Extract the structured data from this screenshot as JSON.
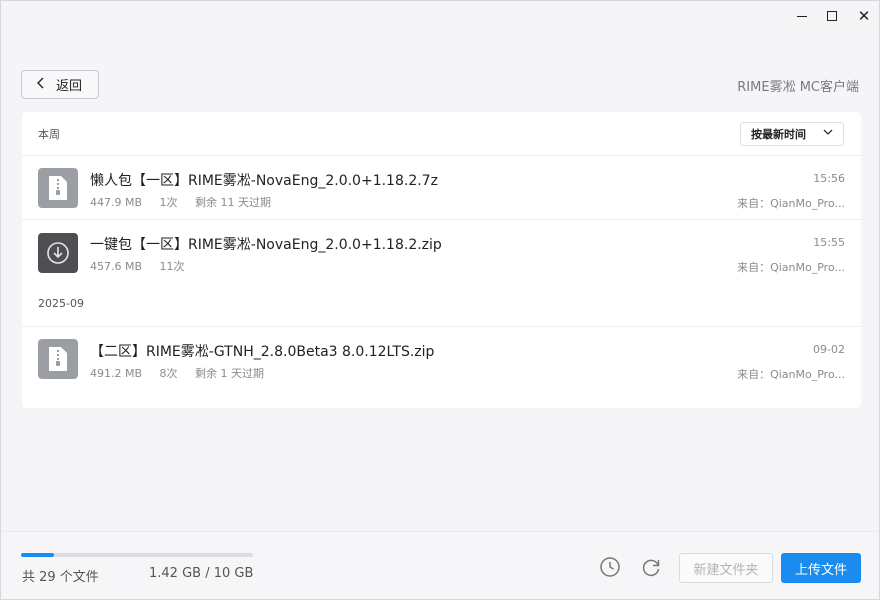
{
  "window": {
    "controls": {
      "minimize": "minimize",
      "maximize": "maximize",
      "close": "close"
    }
  },
  "header": {
    "back_label": "返回",
    "app_title": "RIME雾凇 MC客户端"
  },
  "toolbar": {
    "sort_label": "按最新时间"
  },
  "groups": [
    {
      "label": "本周",
      "files": [
        {
          "name": "懒人包【一区】RIME雾凇-NovaEng_2.0.0+1.18.2.7z",
          "size": "447.9 MB",
          "downloads": "1次",
          "expiry": "剩余 11 天过期",
          "time": "15:56",
          "from": "来自：QianMo_Pro...",
          "icon": "zip-file-icon"
        },
        {
          "name": "一键包【一区】RIME雾凇-NovaEng_2.0.0+1.18.2.zip",
          "size": "457.6 MB",
          "downloads": "11次",
          "expiry": "",
          "time": "15:55",
          "from": "来自：QianMo_Pro...",
          "icon": "download-icon"
        }
      ]
    },
    {
      "label": "2025-09",
      "files": [
        {
          "name": "【二区】RIME雾凇-GTNH_2.8.0Beta3 8.0.12LTS.zip",
          "size": "491.2 MB",
          "downloads": "8次",
          "expiry": "剩余 1 天过期",
          "time": "09-02",
          "from": "来自：QianMo_Pro...",
          "icon": "zip-file-icon"
        }
      ]
    }
  ],
  "footer": {
    "storage_fraction": 0.142,
    "file_count": "共 29 个文件",
    "storage_used": "1.42 GB / 10 GB",
    "new_folder_label": "新建文件夹",
    "upload_label": "上传文件"
  },
  "colors": {
    "accent": "#1a8cf0",
    "icon_gray": "#9b9ea3",
    "icon_dark": "#4d4f53"
  }
}
